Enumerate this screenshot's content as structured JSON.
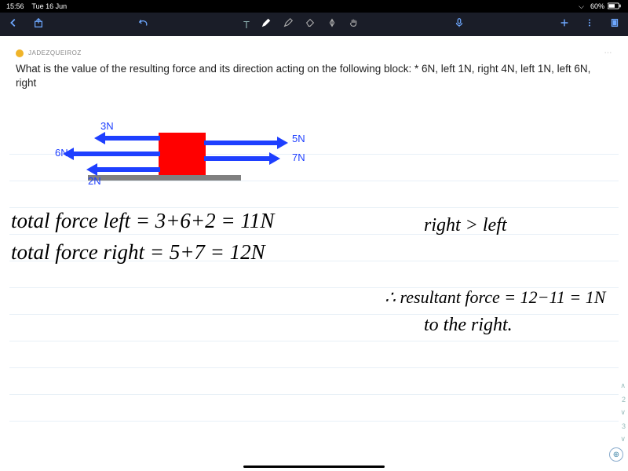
{
  "status": {
    "time": "15:56",
    "date": "Tue 16 Jun",
    "battery": "60%"
  },
  "author": {
    "name": "JADEZQUEIROZ"
  },
  "question": "What is the value of the resulting force and its direction acting on the following block: * 6N, left 1N, right 4N, left 1N, left 6N, right",
  "diagram": {
    "f3n": "3N",
    "f6n": "6N",
    "f2n": "2N",
    "f5n": "5N",
    "f7n": "7N"
  },
  "hand": {
    "left_eq": "total force left = 3+6+2 = 11N",
    "right_eq": "total force right = 5+7 = 12N",
    "compare": "right > left",
    "therefore": "∴ resultant force = 12−11 = 1N",
    "direction": "to the right."
  },
  "side": {
    "p2": "2",
    "p3": "3"
  }
}
